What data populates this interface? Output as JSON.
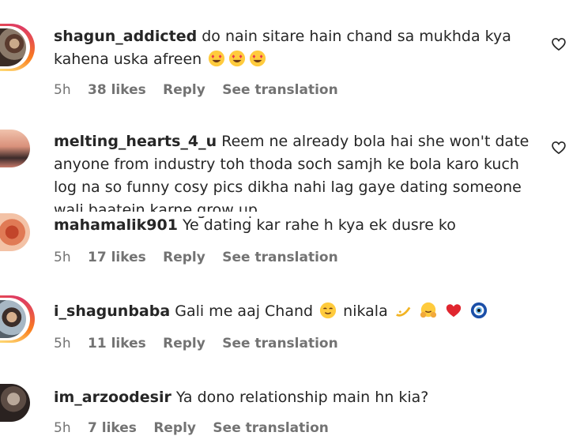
{
  "comments": [
    {
      "username": "shagun_addicted",
      "text": "do nain sitare hain chand sa mukhda kya kahena uska afreen",
      "time": "5h",
      "likes": "38 likes",
      "reply": "Reply",
      "translate": "See translation"
    },
    {
      "username": "melting_hearts_4_u",
      "text": "Reem ne already bola hai she won't date anyone from industry toh thoda soch samjh ke bola karo kuch log na so funny cosy pics dikha nahi lag gaye dating someone wali baatein karne grow up"
    },
    {
      "username": "mahamalik901",
      "text": "Ye dating kar rahe h kya ek dusre ko",
      "time": "5h",
      "likes": "17 likes",
      "reply": "Reply",
      "translate": "See translation"
    },
    {
      "username": "i_shagunbaba",
      "text_a": "Gali me aaj Chand",
      "text_b": "nikala",
      "time": "5h",
      "likes": "11 likes",
      "reply": "Reply",
      "translate": "See translation"
    },
    {
      "username": "im_arzoodesir",
      "text": "Ya dono relationship main hn kia?",
      "time": "5h",
      "likes": "7 likes",
      "reply": "Reply",
      "translate": "See translation"
    }
  ],
  "icons": {
    "heart": "heart-outline-icon",
    "emoji_love": "heart-eyes-emoji",
    "emoji_relieved": "smiling-face-emoji",
    "emoji_dizzy": "dizzy-emoji",
    "emoji_hug": "hugging-face-emoji",
    "emoji_heart": "red-heart-emoji",
    "emoji_eye": "nazar-amulet-emoji"
  },
  "colors": {
    "text": "#262626",
    "meta": "#737373",
    "story_ring_start": "#d62976",
    "story_ring_end": "#feda75"
  }
}
